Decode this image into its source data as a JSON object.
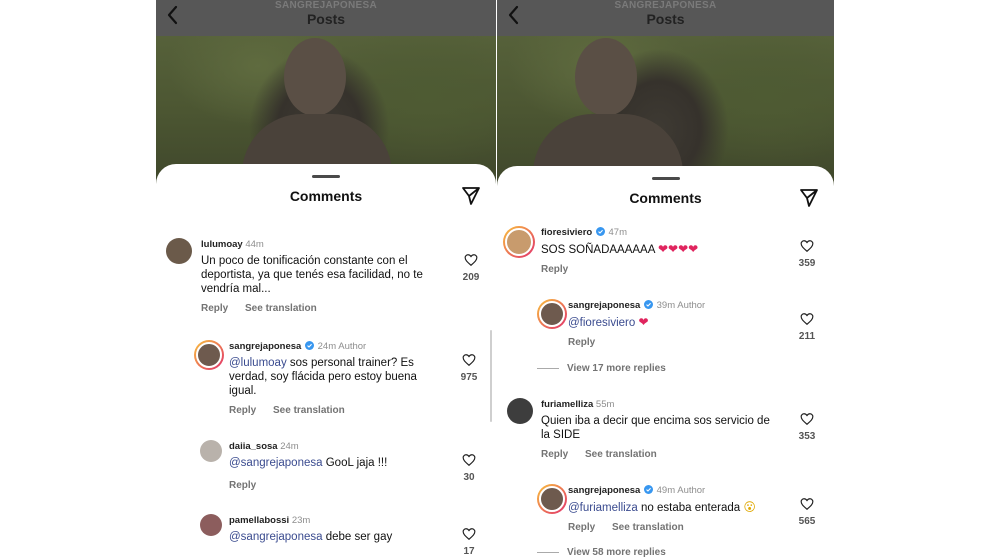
{
  "left": {
    "header": {
      "username": "SANGREJAPONESA",
      "title": "Posts"
    },
    "sheet_title": "Comments",
    "comments": [
      {
        "user": "lulumoay",
        "time": "44m",
        "text": "Un poco de tonificación constante con el deportista, ya que tenés esa facilidad, no te vendría mal...",
        "likes": "209",
        "reply": "Reply",
        "translate": "See translation"
      },
      {
        "user": "sangrejaponesa",
        "time": "24m",
        "author": "Author",
        "mention": "@lulumoay",
        "text": " sos personal trainer? Es verdad, soy flácida pero estoy buena igual.",
        "likes": "975",
        "reply": "Reply",
        "translate": "See translation"
      },
      {
        "user": "daiia_sosa",
        "time": "24m",
        "mention": "@sangrejaponesa",
        "text": " GooL jaja !!!",
        "likes": "30",
        "reply": "Reply"
      },
      {
        "user": "pamellabossi",
        "time": "23m",
        "mention": "@sangrejaponesa",
        "text": " debe ser gay",
        "likes": "17"
      }
    ]
  },
  "right": {
    "header": {
      "username": "SANGREJAPONESA",
      "title": "Posts"
    },
    "sheet_title": "Comments",
    "comments": [
      {
        "user": "fioresiviero",
        "time": "47m",
        "text": "SOS SOÑADAAAAAA ",
        "emoji": "❤❤❤❤",
        "likes": "359",
        "reply": "Reply"
      },
      {
        "user": "sangrejaponesa",
        "time": "39m",
        "author": "Author",
        "mention": "@fioresiviero",
        "emoji": "❤",
        "likes": "211",
        "reply": "Reply",
        "view_more": "View 17 more replies"
      },
      {
        "user": "furiamelliza",
        "time": "55m",
        "text": "Quien iba a decir que encima sos servicio de la SIDE",
        "likes": "353",
        "reply": "Reply",
        "translate": "See translation"
      },
      {
        "user": "sangrejaponesa",
        "time": "49m",
        "author": "Author",
        "mention": "@furiamelliza",
        "text": " no estaba enterada ",
        "emoji": "😮",
        "likes": "565",
        "reply": "Reply",
        "translate": "See translation",
        "view_more": "View 58 more replies"
      }
    ]
  },
  "colors": {
    "mention": "#3a4b8f",
    "verified": "#3897f0",
    "heart": "#e0245e",
    "header_overlay": "#575757"
  },
  "icons": [
    "back-icon",
    "share-icon",
    "heart-icon",
    "verified-icon"
  ]
}
